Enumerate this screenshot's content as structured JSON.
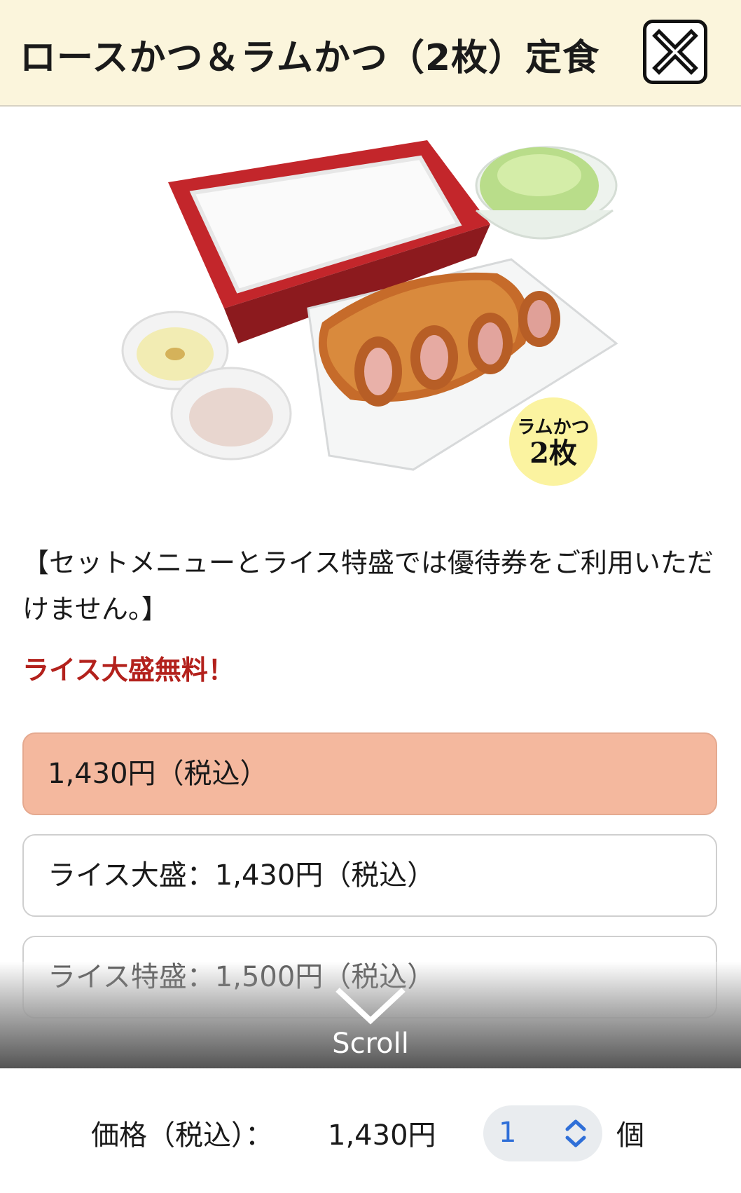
{
  "header": {
    "title": "ロースかつ＆ラムかつ（2枚）定食",
    "close_icon": "close-icon"
  },
  "photo": {
    "badge_line1": "ラムかつ",
    "badge_line2": "2枚"
  },
  "notice": "【セットメニューとライス特盛では優待券をご利用いただけません。】",
  "promo": "ライス大盛無料！",
  "options": [
    {
      "label": "1,430円（税込）",
      "selected": true
    },
    {
      "label": "ライス大盛：1,430円（税込）",
      "selected": false
    },
    {
      "label": "ライス特盛：1,500円（税込）",
      "selected": false
    }
  ],
  "scroll": {
    "label": "Scroll",
    "icon": "chevron-down-icon"
  },
  "footer": {
    "price_label": "価格（税込）：",
    "price_value": "1,430円",
    "quantity": "1",
    "quantity_icon": "up-down-chevron-icon",
    "unit": "個"
  },
  "colors": {
    "header_bg": "#fbf5dc",
    "selected_option": "#f4b89e",
    "promo_red": "#b3211c",
    "quantity_blue": "#2f6fd8"
  }
}
